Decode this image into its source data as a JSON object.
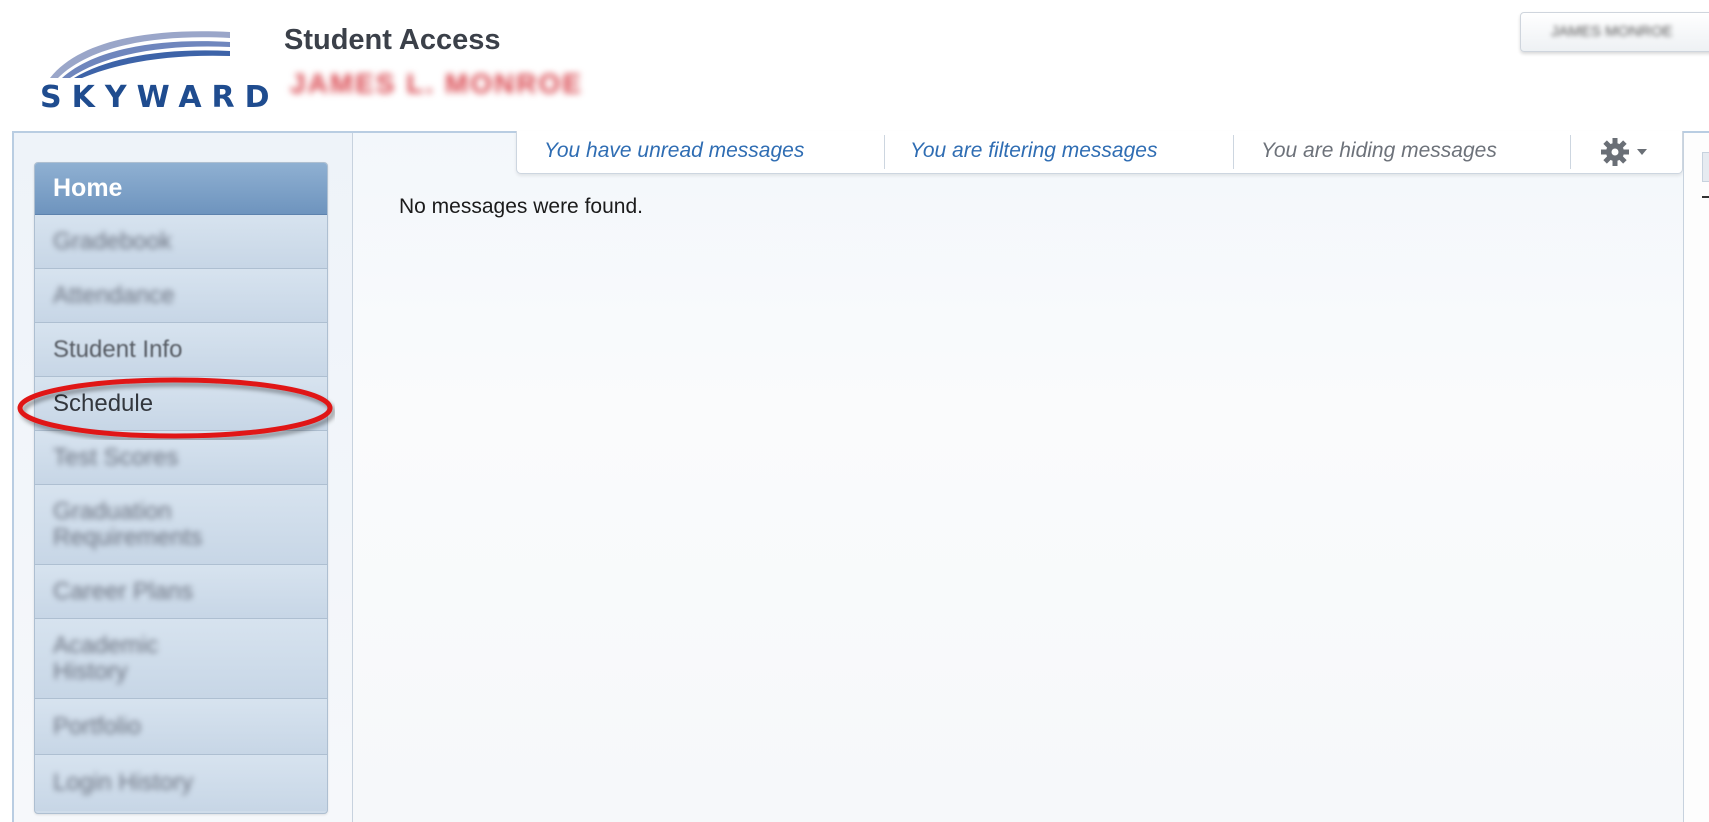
{
  "header": {
    "logo_text": "SKYWARD",
    "app_title": "Student Access",
    "student_name": "JAMES L. MONROE",
    "user_menu_label": "JAMES MONROE"
  },
  "sidebar": {
    "items": [
      {
        "label": "Home",
        "state": "active"
      },
      {
        "label": "Gradebook",
        "state": "blurred"
      },
      {
        "label": "Attendance",
        "state": "blurred"
      },
      {
        "label": "Student Info",
        "state": "dim"
      },
      {
        "label": "Schedule",
        "state": "highlighted"
      },
      {
        "label": "Test Scores",
        "state": "blurred"
      },
      {
        "label": "Graduation Requirements",
        "state": "blurred"
      },
      {
        "label": "Career Plans",
        "state": "blurred"
      },
      {
        "label": "Academic History",
        "state": "blurred"
      },
      {
        "label": "Portfolio",
        "state": "blurred"
      },
      {
        "label": "Login History",
        "state": "blurred"
      }
    ]
  },
  "messages": {
    "unread": "You have unread messages",
    "filtering": "You are filtering messages",
    "hiding": "You are hiding messages",
    "gear_icon": "gear-icon",
    "empty_text": "No messages were found."
  },
  "colors": {
    "brand_blue": "#1f4c8f",
    "nav_active": "#7a9ec6",
    "link_blue": "#2f6db3",
    "highlight_red": "#e01818"
  }
}
